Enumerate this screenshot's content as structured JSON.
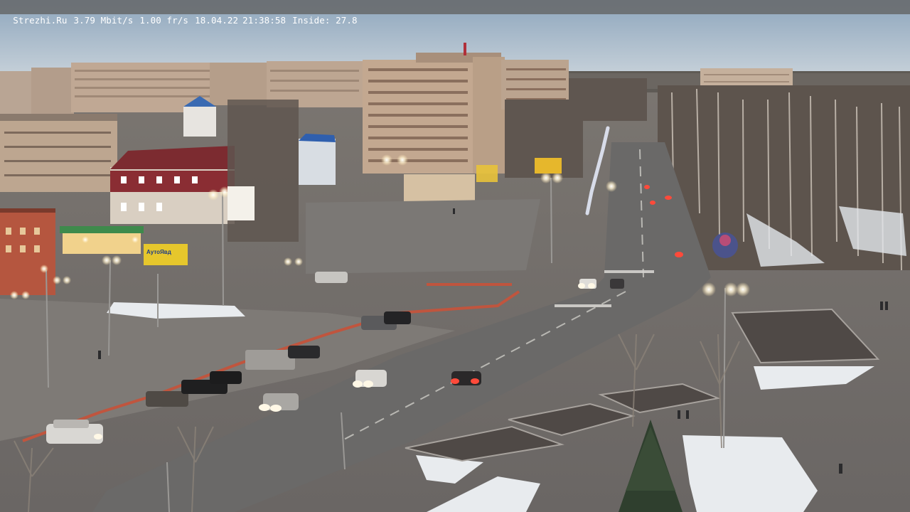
{
  "camera_overlay": {
    "site": "Strezhi.Ru",
    "bitrate": "3.79 Mbit/s",
    "framerate": "1.00 fr/s",
    "date": "18.04.22",
    "time": "21:38:58",
    "inside": "Inside: 27.8"
  },
  "signs": {
    "left_billboard": "АутоЯвд"
  },
  "colors": {
    "sky": "#a9bccd",
    "road": "#6d6d6b",
    "snow": "#e9ecef",
    "building_beige": "#bfa793",
    "building_red": "#7c2b30",
    "streetlight": "#fff6df",
    "overlay_bar": "#696c70"
  }
}
